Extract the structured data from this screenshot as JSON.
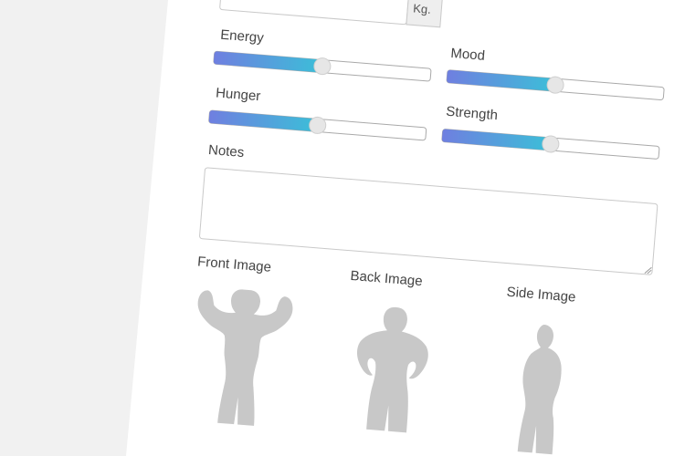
{
  "weight": {
    "value": "",
    "unit": "Kg."
  },
  "sliders": {
    "energy": {
      "label": "Energy",
      "value": 0.5
    },
    "mood": {
      "label": "Mood",
      "value": 0.5
    },
    "hunger": {
      "label": "Hunger",
      "value": 0.5
    },
    "strength": {
      "label": "Strength",
      "value": 0.5
    }
  },
  "notes": {
    "label": "Notes",
    "value": ""
  },
  "images": {
    "front": {
      "label": "Front Image",
      "icon": "front-pose-silhouette-icon"
    },
    "back": {
      "label": "Back Image",
      "icon": "back-pose-silhouette-icon"
    },
    "side": {
      "label": "Side Image",
      "icon": "side-pose-silhouette-icon"
    }
  },
  "colors": {
    "slider_gradient_start": "#6f7fe0",
    "slider_gradient_end": "#3bbfd8",
    "silhouette": "#c8c8c8",
    "background": "#f1f1f1",
    "card": "#ffffff"
  }
}
